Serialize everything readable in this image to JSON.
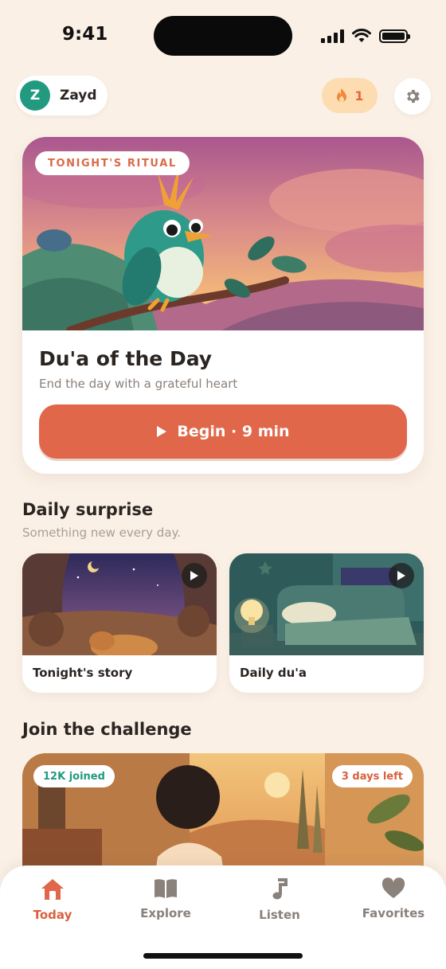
{
  "status": {
    "time": "9:41"
  },
  "header": {
    "avatar_initial": "Z",
    "profile_name": "Zayd",
    "streak_count": "1",
    "streak_icon": "flame-icon",
    "settings_icon": "gear-icon"
  },
  "ritual": {
    "tag": "TONIGHT'S RITUAL",
    "title": "Du'a of the Day",
    "subtitle": "End the day with a grateful heart",
    "button_label": "Begin · 9 min"
  },
  "daily_surprise": {
    "title": "Daily surprise",
    "subtitle": "Something new every day.",
    "cards": [
      {
        "label": "Tonight's story"
      },
      {
        "label": "Daily du'a"
      }
    ]
  },
  "challenge": {
    "title": "Join the challenge",
    "joined": "12K joined",
    "days_left": "3 days left"
  },
  "tabs": [
    {
      "label": "Today",
      "icon": "home-icon",
      "active": true
    },
    {
      "label": "Explore",
      "icon": "book-icon",
      "active": false
    },
    {
      "label": "Listen",
      "icon": "music-note-icon",
      "active": false
    },
    {
      "label": "Favorites",
      "icon": "heart-icon",
      "active": false
    }
  ],
  "colors": {
    "background": "#faf0e6",
    "accent": "#e0674a",
    "avatar": "#229a80",
    "streak_bg": "#fcdcb0",
    "joined_text": "#229a80",
    "days_left_text": "#d9603f"
  }
}
